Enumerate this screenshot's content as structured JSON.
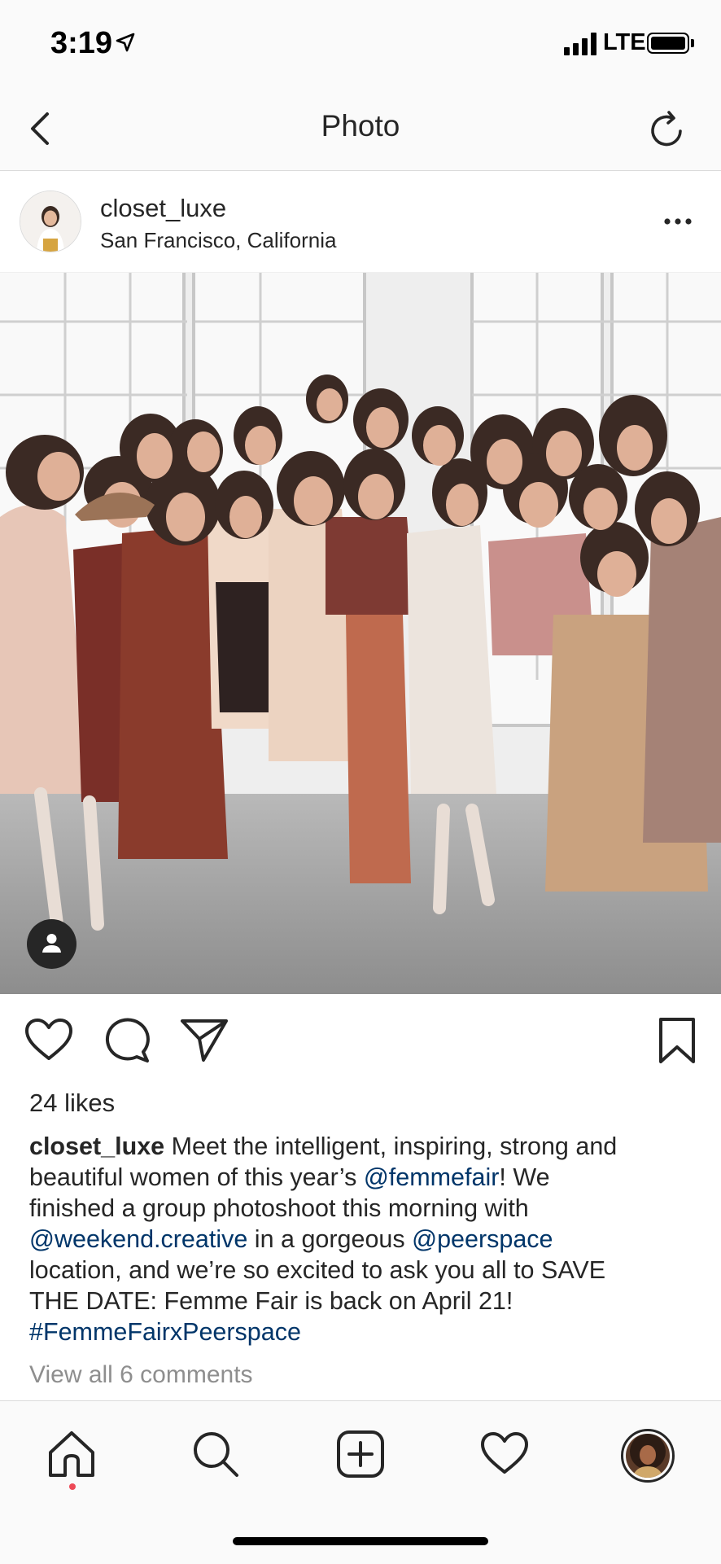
{
  "status_bar": {
    "time": "3:19",
    "network": "LTE",
    "icons": [
      "location-arrow-icon",
      "signal-icon",
      "battery-icon"
    ]
  },
  "nav": {
    "title": "Photo",
    "icons": [
      "back-chevron-icon",
      "refresh-icon"
    ]
  },
  "post": {
    "username": "closet_luxe",
    "location": "San Francisco, California",
    "image_description_icon": "user-tag-icon",
    "likes": "24 likes",
    "caption": {
      "username": "closet_luxe",
      "lines": [
        [
          {
            "text": " Meet the intelligent, inspiring, strong and"
          }
        ],
        [
          {
            "text": "beautiful women of this year’s "
          },
          {
            "text": "@femmefair",
            "link": true
          },
          {
            "text": "! We"
          }
        ],
        [
          {
            "text": "finished a group photoshoot this morning with"
          }
        ],
        [
          {
            "text": "@weekend.creative",
            "link": true
          },
          {
            "text": " in a gorgeous "
          },
          {
            "text": "@peerspace",
            "link": true
          }
        ],
        [
          {
            "text": "location, and we’re so excited to ask you all to SAVE"
          }
        ],
        [
          {
            "text": "THE DATE: Femme Fair is back on April 21!"
          }
        ],
        [
          {
            "text": "#FemmeFairxPeerspace",
            "link": true
          }
        ]
      ]
    },
    "view_comments": "View all 6 comments"
  },
  "action_icons": [
    "heart-icon",
    "comment-icon",
    "share-icon",
    "bookmark-icon"
  ],
  "tab_bar": [
    "home-icon",
    "search-icon",
    "new-post-icon",
    "activity-heart-icon",
    "profile-avatar"
  ],
  "colors": {
    "text": "#262626",
    "link": "#003569",
    "muted": "#8e8e8e",
    "notification_dot": "#ed4956",
    "bar_background": "#fafafa",
    "divider": "#dbdbdb"
  }
}
